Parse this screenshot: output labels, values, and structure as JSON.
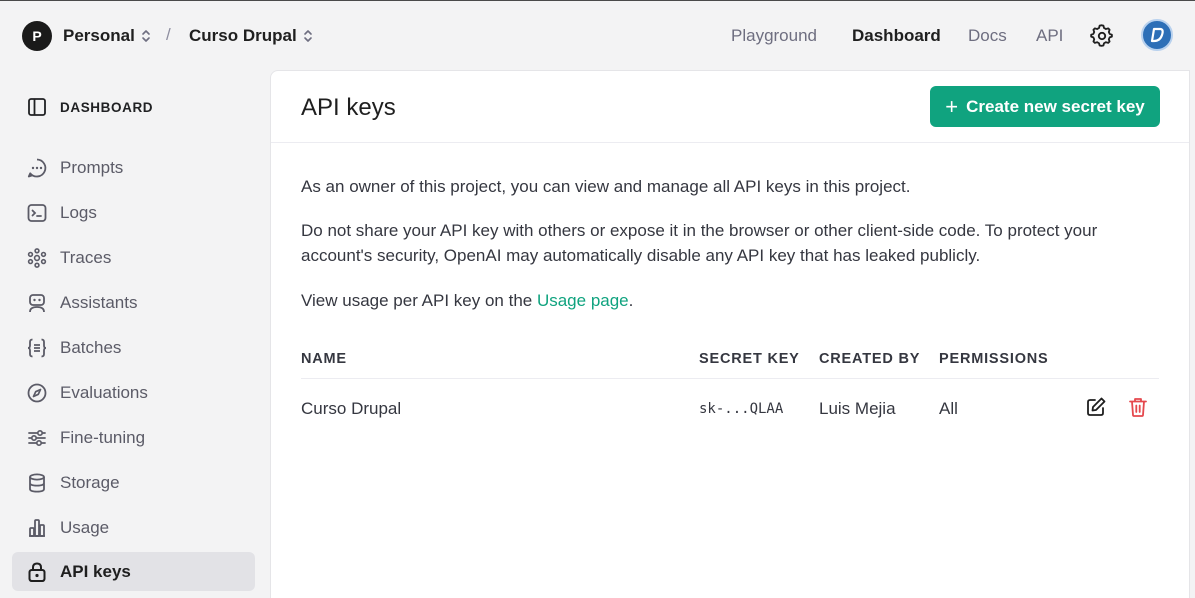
{
  "topbar": {
    "org_initial": "P",
    "org_name": "Personal",
    "separator": "/",
    "project_name": "Curso Drupal",
    "nav": [
      "Playground",
      "Dashboard",
      "Docs",
      "API"
    ],
    "active_nav": "Dashboard"
  },
  "sidebar": {
    "header": "DASHBOARD",
    "items": [
      {
        "label": "Prompts",
        "icon": "chat-bubble-icon"
      },
      {
        "label": "Logs",
        "icon": "terminal-icon"
      },
      {
        "label": "Traces",
        "icon": "traces-icon"
      },
      {
        "label": "Assistants",
        "icon": "robot-icon"
      },
      {
        "label": "Batches",
        "icon": "braces-icon"
      },
      {
        "label": "Evaluations",
        "icon": "compass-icon"
      },
      {
        "label": "Fine-tuning",
        "icon": "sliders-icon"
      },
      {
        "label": "Storage",
        "icon": "database-icon"
      },
      {
        "label": "Usage",
        "icon": "bar-chart-icon"
      },
      {
        "label": "API keys",
        "icon": "lock-icon"
      }
    ],
    "active_item": "API keys"
  },
  "main": {
    "title": "API keys",
    "create_button": "Create new secret key",
    "intro": "As an owner of this project, you can view and manage all API keys in this project.",
    "warning": "Do not share your API key with others or expose it in the browser or other client-side code. To protect your account's security, OpenAI may automatically disable any API key that has leaked publicly.",
    "usage_prefix": "View usage per API key on the ",
    "usage_link": "Usage page",
    "usage_suffix": ".",
    "table": {
      "columns": [
        "NAME",
        "SECRET KEY",
        "CREATED BY",
        "PERMISSIONS"
      ],
      "rows": [
        {
          "name": "Curso Drupal",
          "secret_key": "sk-...QLAA",
          "created_by": "Luis Mejia",
          "permissions": "All"
        }
      ]
    }
  },
  "colors": {
    "accent": "#10a37f",
    "danger": "#e5484d",
    "active_bg": "#e2e2e6"
  }
}
